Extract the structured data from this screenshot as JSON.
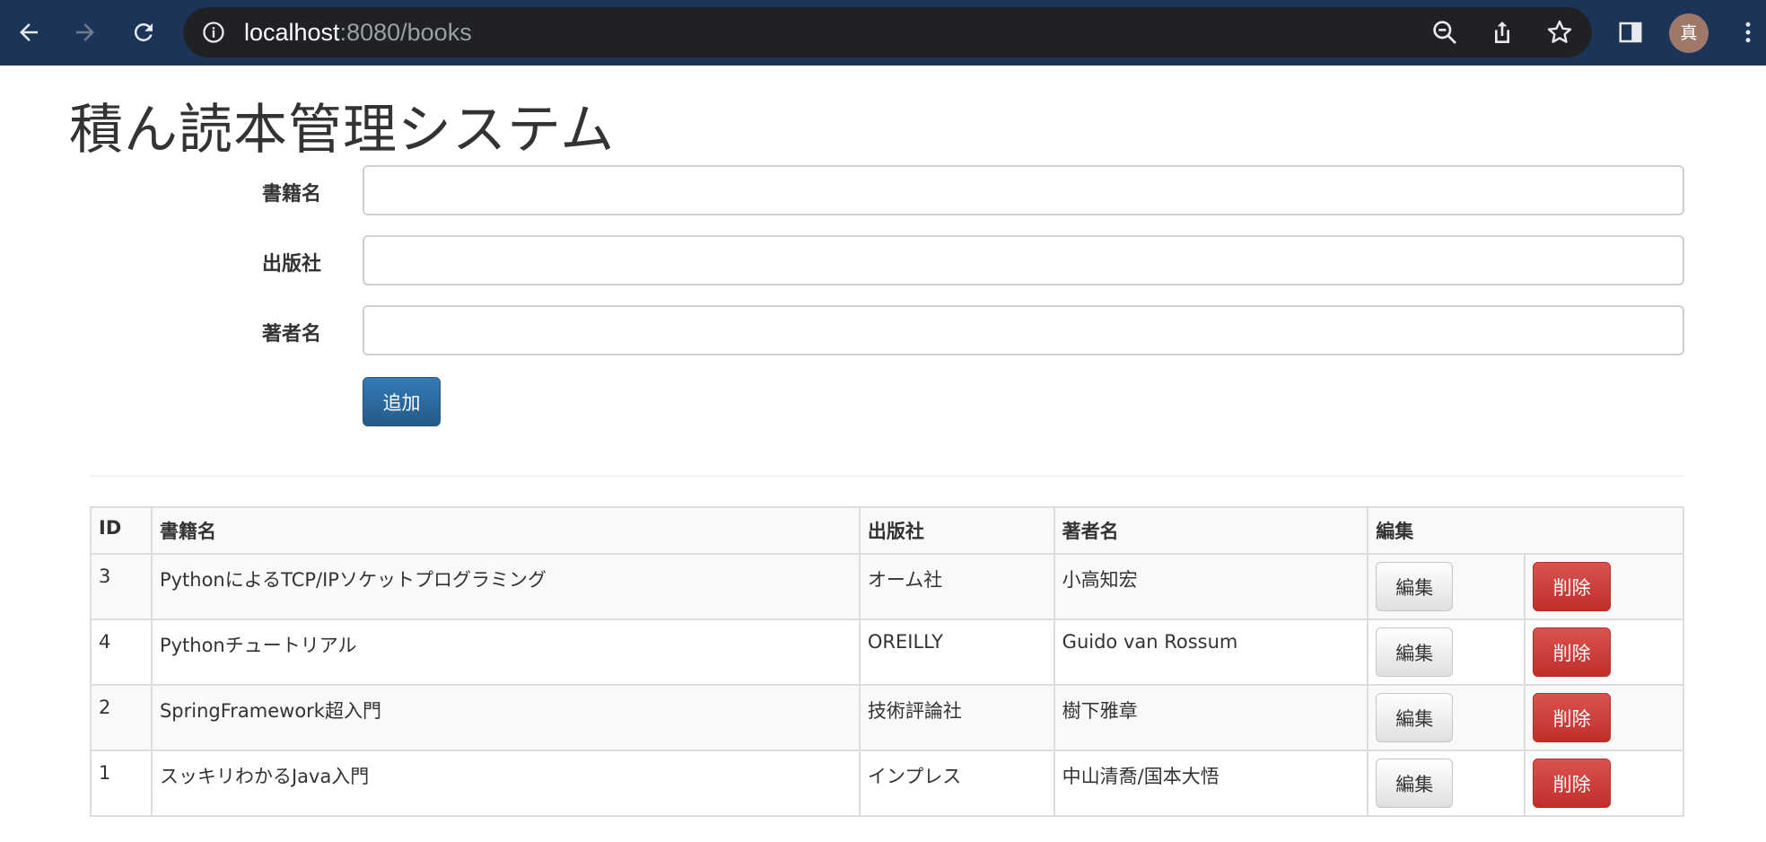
{
  "browser": {
    "url_host": "localhost",
    "url_rest": ":8080/books",
    "avatar_text": "真",
    "icons": [
      "back-arrow-icon",
      "forward-arrow-icon",
      "reload-icon",
      "info-icon",
      "zoom-out-icon",
      "share-icon",
      "bookmark-star-icon",
      "side-panel-icon",
      "kebab-menu-icon"
    ]
  },
  "page": {
    "title": "積ん読本管理システム"
  },
  "form": {
    "title_label": "書籍名",
    "publisher_label": "出版社",
    "author_label": "著者名",
    "title_value": "",
    "publisher_value": "",
    "author_value": "",
    "add_label": "追加"
  },
  "table": {
    "headers": {
      "id": "ID",
      "title": "書籍名",
      "publisher": "出版社",
      "author": "著者名",
      "edit": "編集"
    },
    "rows": [
      {
        "id": "3",
        "title": "PythonによるTCP/IPソケットプログラミング",
        "publisher": "オーム社",
        "author": "小高知宏",
        "edit_label": "編集",
        "delete_label": "削除"
      },
      {
        "id": "4",
        "title": "Pythonチュートリアル",
        "publisher": "OREILLY",
        "author": "Guido van Rossum",
        "edit_label": "編集",
        "delete_label": "削除"
      },
      {
        "id": "2",
        "title": "SpringFramework超入門",
        "publisher": "技術評論社",
        "author": "樹下雅章",
        "edit_label": "編集",
        "delete_label": "削除"
      },
      {
        "id": "1",
        "title": "スッキリわかるJava入門",
        "publisher": "インプレス",
        "author": "中山清喬/国本大悟",
        "edit_label": "編集",
        "delete_label": "削除"
      }
    ]
  },
  "colors": {
    "chrome_bg": "#1d3459",
    "omnibox_bg": "#202124",
    "primary_button": "#337ab7",
    "danger_button": "#d9534f"
  }
}
